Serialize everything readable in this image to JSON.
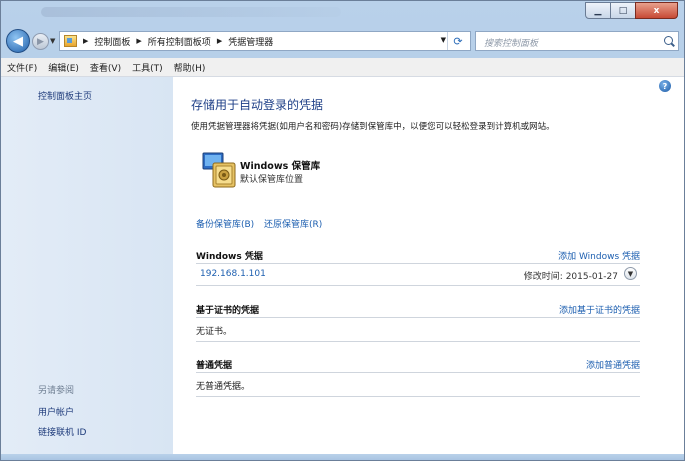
{
  "window": {
    "minimize_glyph": "▁",
    "maximize_glyph": "□",
    "close_glyph": "x"
  },
  "nav": {
    "back_glyph": "◀",
    "forward_glyph": "▶",
    "breadcrumbs": [
      "控制面板",
      "所有控制面板项",
      "凭据管理器"
    ],
    "search_placeholder": "搜索控制面板"
  },
  "menu": [
    "文件(F)",
    "编辑(E)",
    "查看(V)",
    "工具(T)",
    "帮助(H)"
  ],
  "sidebar": {
    "home": "控制面板主页",
    "see_also": "另请参阅",
    "links": [
      "用户帐户",
      "链接联机 ID"
    ]
  },
  "main": {
    "help_glyph": "?",
    "title": "存储用于自动登录的凭据",
    "description": "使用凭据管理器将凭据(如用户名和密码)存储到保管库中，以便您可以轻松登录到计算机或网站。",
    "vault": {
      "name": "Windows 保管库",
      "subtitle": "默认保管库位置"
    },
    "backup_link": "备份保管库(B)",
    "restore_link": "还原保管库(R)",
    "sections": {
      "windows": {
        "title": "Windows 凭据",
        "add": "添加 Windows 凭据",
        "entry": "192.168.1.101",
        "modified": "修改时间: 2015-01-27"
      },
      "certificate": {
        "title": "基于证书的凭据",
        "add": "添加基于证书的凭据",
        "empty": "无证书。"
      },
      "generic": {
        "title": "普通凭据",
        "add": "添加普通凭据",
        "empty": "无普通凭据。"
      }
    }
  },
  "icons": {
    "address": "control-panel-icon",
    "refresh": "refresh-icon",
    "search": "search-icon",
    "help": "help-icon",
    "vault": "vault-icon",
    "expand": "chevron-down-icon"
  }
}
